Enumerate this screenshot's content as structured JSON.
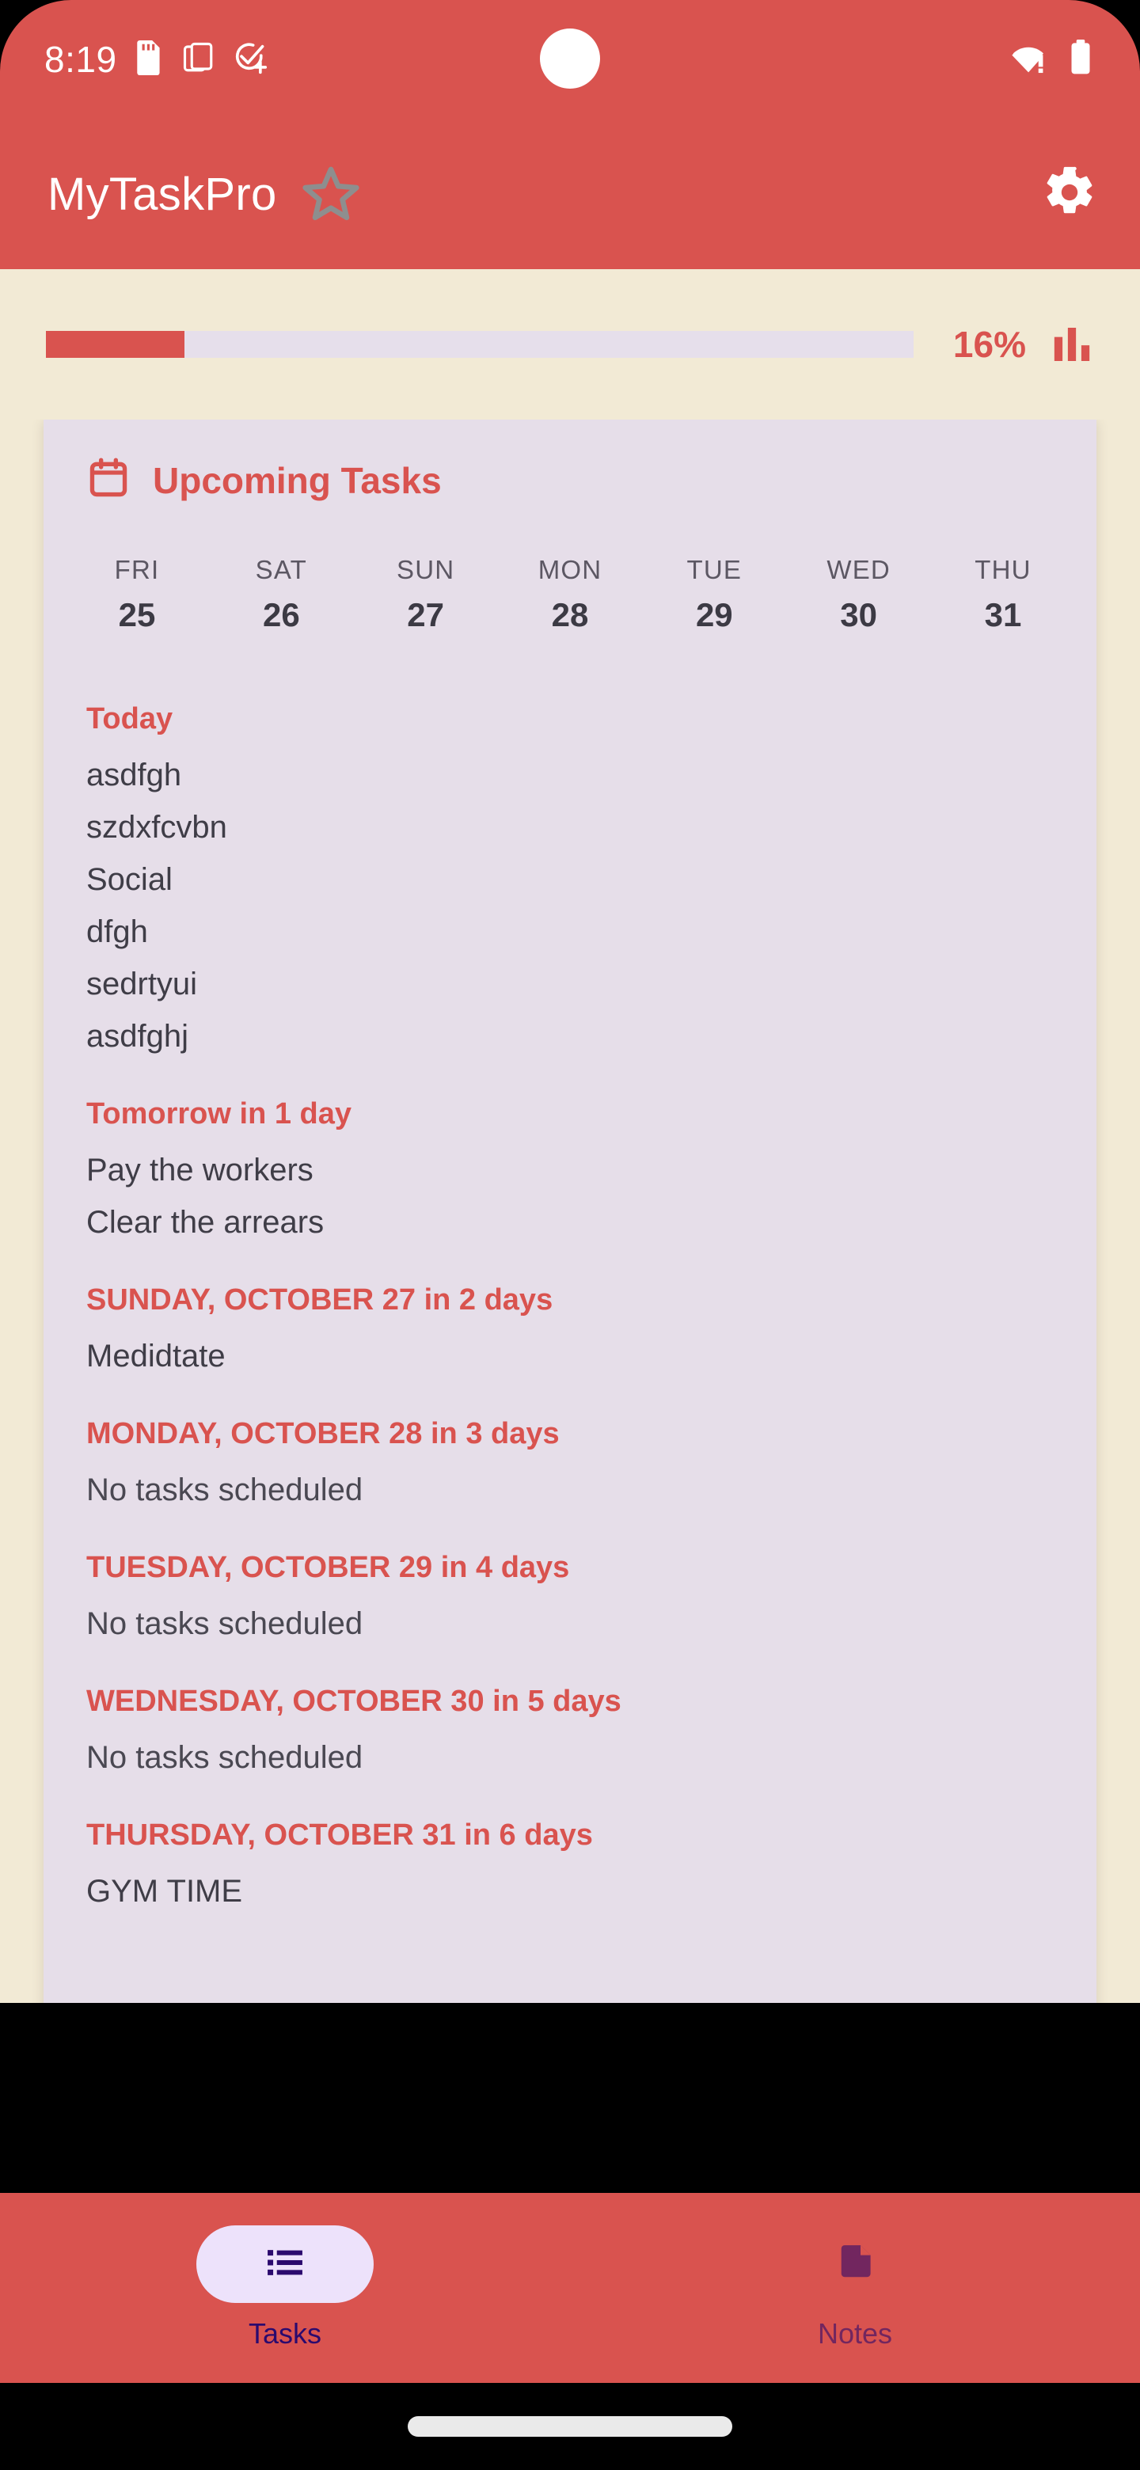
{
  "status_bar": {
    "clock": "8:19",
    "icons_left": [
      "sd-card-icon",
      "multi-window-icon",
      "task-add-check-icon"
    ],
    "icons_right": [
      "wifi-no-internet-icon",
      "battery-full-icon"
    ]
  },
  "app_bar": {
    "title": "MyTaskPro",
    "star_icon": "star-outline-icon",
    "settings_icon": "gear-icon"
  },
  "progress": {
    "percent_label": "16%",
    "percent_value": 16,
    "chart_icon": "bar-chart-icon",
    "fill_color": "#D9534F",
    "track_color": "#E6DFEB"
  },
  "card": {
    "title": "Upcoming Tasks",
    "calendar_icon": "calendar-icon",
    "accent_color": "#D9534F",
    "background_color": "#E6DEE9",
    "days": [
      {
        "name": "FRI",
        "number": "25"
      },
      {
        "name": "SAT",
        "number": "26"
      },
      {
        "name": "SUN",
        "number": "27"
      },
      {
        "name": "MON",
        "number": "28"
      },
      {
        "name": "TUE",
        "number": "29"
      },
      {
        "name": "WED",
        "number": "30"
      },
      {
        "name": "THU",
        "number": "31"
      }
    ],
    "sections": [
      {
        "heading": "Today",
        "tasks": [
          "asdfgh",
          "szdxfcvbn",
          "Social",
          "dfgh",
          "sedrtyui",
          "asdfghj"
        ]
      },
      {
        "heading": "Tomorrow in 1 day",
        "tasks": [
          "Pay the workers",
          "Clear the arrears"
        ]
      },
      {
        "heading": "SUNDAY, OCTOBER 27 in 2 days",
        "tasks": [
          "Medidtate"
        ]
      },
      {
        "heading": "MONDAY, OCTOBER 28 in 3 days",
        "tasks": [
          "No tasks scheduled"
        ]
      },
      {
        "heading": "TUESDAY, OCTOBER 29 in 4 days",
        "tasks": [
          "No tasks scheduled"
        ]
      },
      {
        "heading": "WEDNESDAY, OCTOBER 30 in 5 days",
        "tasks": [
          "No tasks scheduled"
        ]
      },
      {
        "heading": "THURSDAY, OCTOBER 31 in 6 days",
        "tasks": [
          "GYM TIME"
        ]
      }
    ]
  },
  "bottom_nav": {
    "items": [
      {
        "label": "Tasks",
        "icon": "list-icon",
        "active": true
      },
      {
        "label": "Notes",
        "icon": "note-page-icon",
        "active": false
      }
    ]
  },
  "theme": {
    "primary": "#D9534F",
    "page_background": "#F2EAD5",
    "nav_active_pill": "#EDE2FB",
    "nav_active_text": "#2B0A6E",
    "nav_inactive_text": "#72265F"
  }
}
